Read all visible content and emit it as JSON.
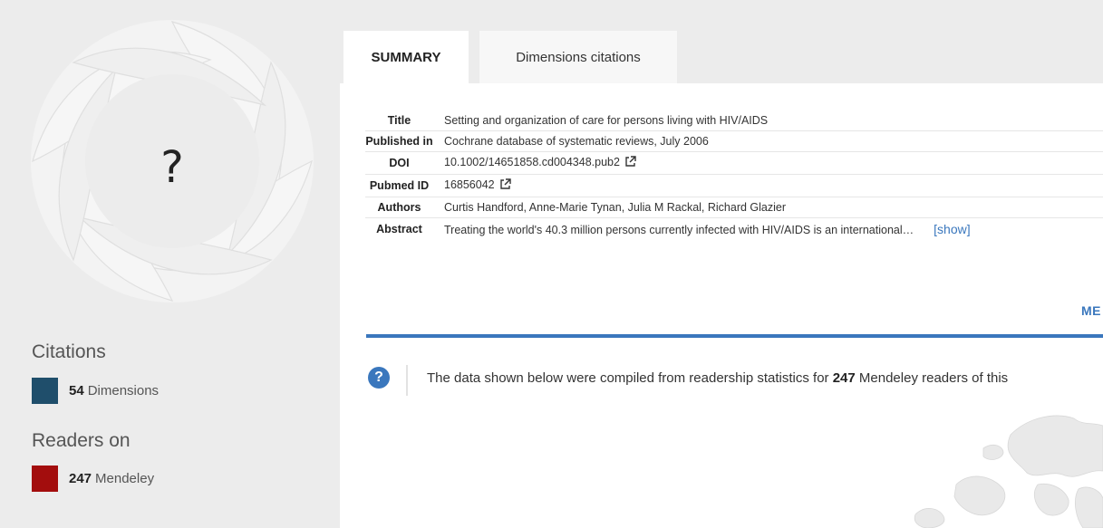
{
  "sidebar": {
    "badge_symbol": "?",
    "citations": {
      "heading": "Citations",
      "count": "54",
      "source": "Dimensions",
      "color": "#1f4e6b"
    },
    "readers": {
      "heading": "Readers on",
      "count": "247",
      "source": "Mendeley",
      "color": "#a30d0d"
    }
  },
  "tabs": [
    {
      "label": "SUMMARY",
      "active": true
    },
    {
      "label": "Dimensions citations",
      "active": false
    }
  ],
  "summary": {
    "rows": [
      {
        "key": "Title",
        "value": "Setting and organization of care for persons living with HIV/AIDS"
      },
      {
        "key": "Published in",
        "value": "Cochrane database of systematic reviews, July 2006"
      },
      {
        "key": "DOI",
        "value": "10.1002/14651858.cd004348.pub2"
      },
      {
        "key": "Pubmed ID",
        "value": "16856042"
      },
      {
        "key": "Authors",
        "value": "Curtis Handford, Anne-Marie Tynan, Julia M Rackal, Richard Glazier"
      },
      {
        "key": "Abstract",
        "value": "Treating the world's 40.3 million persons currently infected with HIV/AIDS is an international…"
      }
    ],
    "show_label": "[show]"
  },
  "more_label": "ME",
  "info": {
    "icon": "question-icon",
    "text_before": "The data shown below were compiled from readership statistics for ",
    "count": "247",
    "text_after": " Mendeley readers of this"
  },
  "colors": {
    "accent": "#3a77bd",
    "sidebar_bg": "#ececec"
  }
}
